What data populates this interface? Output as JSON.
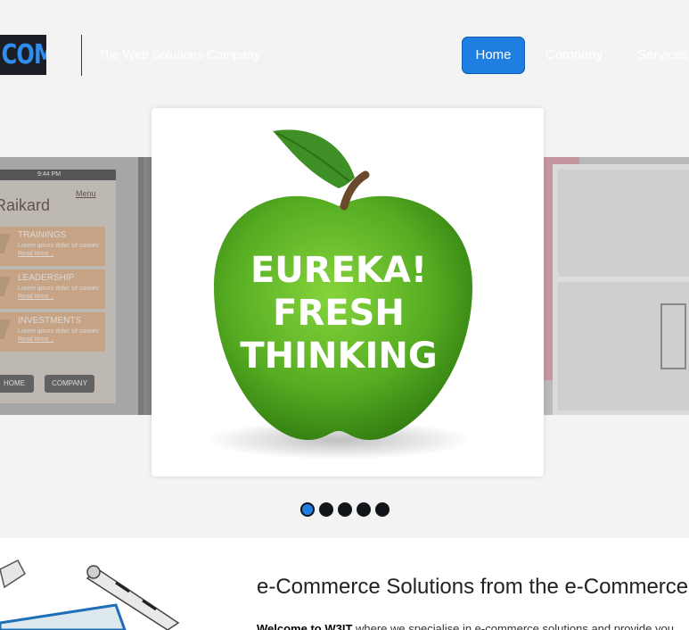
{
  "header": {
    "logo_text": "COM",
    "tagline": "The Web Solutions Company",
    "nav": [
      {
        "label": "Home",
        "active": true
      },
      {
        "label": "Company",
        "active": false
      },
      {
        "label": "Services",
        "active": false
      }
    ]
  },
  "carousel": {
    "left_slide": {
      "status_time": "9:44 PM",
      "app_title": "Raikard",
      "menu_label": "Menu",
      "items": [
        {
          "title": "TRAININGS",
          "desc": "Lorem ipsum dolor sit consec",
          "link": "Read More..."
        },
        {
          "title": "LEADERSHIP",
          "desc": "Lorem ipsum dolor sit consec",
          "link": "Read More..."
        },
        {
          "title": "INVESTMENTS",
          "desc": "Lorem ipsum dolor sit consec",
          "link": "Read More..."
        }
      ],
      "buttons": [
        "HOME",
        "COMPANY"
      ]
    },
    "center_slide": {
      "lines": [
        "EUREKA!",
        "FRESH",
        "THINKING"
      ]
    },
    "dot_count": 5,
    "active_dot": 0
  },
  "content": {
    "heading": "e-Commerce Solutions from the e-Commerce",
    "intro_bold": "Welcome to W3IT",
    "intro_text": " where we specialise in e-commerce solutions and provide you"
  },
  "colors": {
    "accent": "#1f7fe0",
    "background": "#f3f3f3",
    "apple_green": "#5fb52a"
  }
}
